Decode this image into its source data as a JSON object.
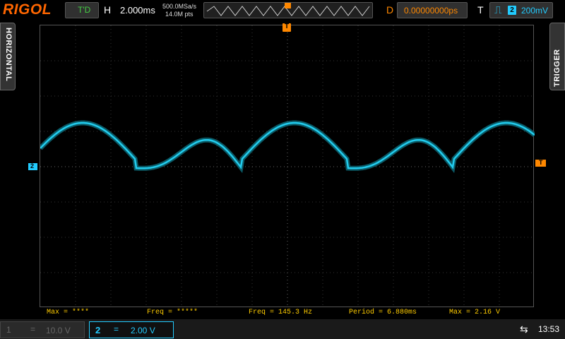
{
  "brand": {
    "logo": "RIGOL"
  },
  "header": {
    "run_status": "T'D",
    "horizontal_label": "H",
    "timebase": "2.000ms",
    "sample_rate": "500.0MSa/s",
    "memory_depth": "14.0M pts",
    "delay_label": "D",
    "delay_value": "0.00000000ps",
    "trigger_label": "T",
    "trigger_source": "2",
    "trigger_level": "200mV"
  },
  "side_tabs": {
    "left": "HORIZONTAL",
    "right": "TRIGGER"
  },
  "markers": {
    "channel_ground": "2",
    "trigger_position": "T"
  },
  "measurements": [
    {
      "label": "Max = ****"
    },
    {
      "label": "Freq = *****"
    },
    {
      "label": "Freq = 145.3 Hz"
    },
    {
      "label": "Period = 6.880ms"
    },
    {
      "label": "Max = 2.16 V"
    }
  ],
  "channels": {
    "ch1": {
      "number": "1",
      "coupling": "=",
      "scale": "10.0 V"
    },
    "ch2": {
      "number": "2",
      "coupling": "=",
      "scale": "2.00 V"
    }
  },
  "status": {
    "usb_icon": "usb-icon",
    "time": "13:53"
  },
  "colors": {
    "ch2": "#22ccee",
    "trigger": "#ff8800",
    "measure": "#ffcc00",
    "brand": "#ff6600"
  }
}
